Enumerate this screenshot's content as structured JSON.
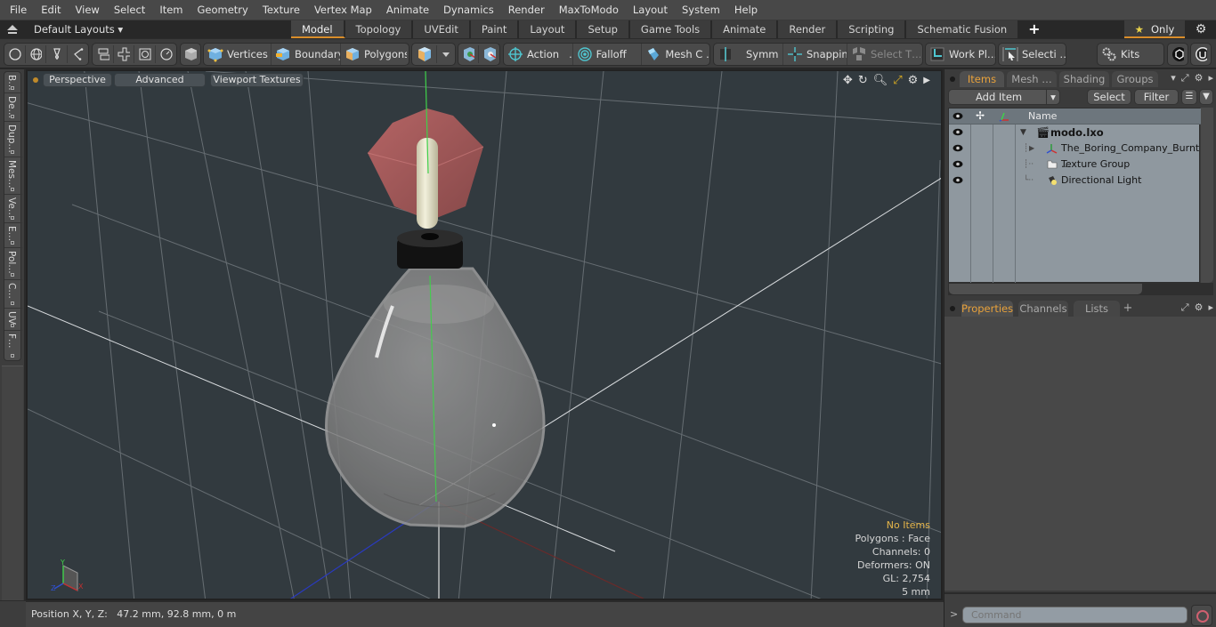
{
  "menu": [
    "File",
    "Edit",
    "View",
    "Select",
    "Item",
    "Geometry",
    "Texture",
    "Vertex Map",
    "Animate",
    "Dynamics",
    "Render",
    "MaxToModo",
    "Layout",
    "System",
    "Help"
  ],
  "layoutbar": {
    "layouts_label": "Default Layouts ▾",
    "tabs": [
      "Model",
      "Topology",
      "UVEdit",
      "Paint",
      "Layout",
      "Setup",
      "Game Tools",
      "Animate",
      "Render",
      "Scripting",
      "Schematic Fusion"
    ],
    "active_tab": "Model",
    "add_tab": "+",
    "only_label": "Only",
    "only_icon": "★",
    "gear_icon": "⚙"
  },
  "toolbar": {
    "vertices": "Vertices",
    "boundary": "Boundary",
    "polygons": "Polygons",
    "action": "Action   …",
    "falloff": "Falloff",
    "mesh_c": "Mesh C …",
    "symm": "Symm …",
    "snapping": "Snapping",
    "select_t": "Select T…",
    "work_pl": "Work Pl…",
    "selecti": "Selecti …",
    "kits": "Kits"
  },
  "left_tabs": [
    "B…",
    "De…",
    "Dup…",
    "Mes…",
    "Ve…",
    "E…",
    "Pol…",
    "C…",
    "UV",
    "F…"
  ],
  "viewport": {
    "view_label": "Perspective",
    "shading_label": "Advanced",
    "texture_label": "Viewport Textures",
    "info": {
      "selection": "No Items",
      "polygons": "Polygons : Face",
      "channels": "Channels: 0",
      "deformers": "Deformers: ON",
      "gl": "GL: 2,754",
      "grid": "5 mm"
    },
    "axis_labels": {
      "x": "X",
      "y": "Y",
      "z": "Z"
    }
  },
  "status": {
    "position": "Position X, Y, Z:   47.2 mm, 92.8 mm, 0 m"
  },
  "items_panel": {
    "tabs": [
      "Items",
      "Mesh …",
      "Shading",
      "Groups"
    ],
    "active_tab": "Items",
    "add_item": "Add Item",
    "select": "Select",
    "filter": "Filter",
    "name_header": "Name",
    "tree": [
      {
        "label": "modo.lxo",
        "level": 0,
        "bold": true,
        "icon": "scene-icon",
        "expanded": true
      },
      {
        "label": "The_Boring_Company_Burnt …",
        "level": 1,
        "icon": "mesh-locator-icon",
        "expandable": true
      },
      {
        "label": "Texture Group",
        "level": 1,
        "icon": "texture-group-icon"
      },
      {
        "label": "Directional Light",
        "level": 1,
        "icon": "light-icon"
      }
    ]
  },
  "properties_panel": {
    "tabs": [
      "Properties",
      "Channels",
      "Lists"
    ],
    "active_tab": "Properties",
    "add_tab": "+"
  },
  "command": {
    "prompt": ">",
    "placeholder": "Command"
  },
  "colors": {
    "accent": "#d98d2a",
    "viewport_bg": "#323a3f",
    "tree_bg": "#8f989f",
    "axis_y": "#3fd14a",
    "axis_x": "#b02a2a",
    "axis_z": "#2a3ac0"
  }
}
